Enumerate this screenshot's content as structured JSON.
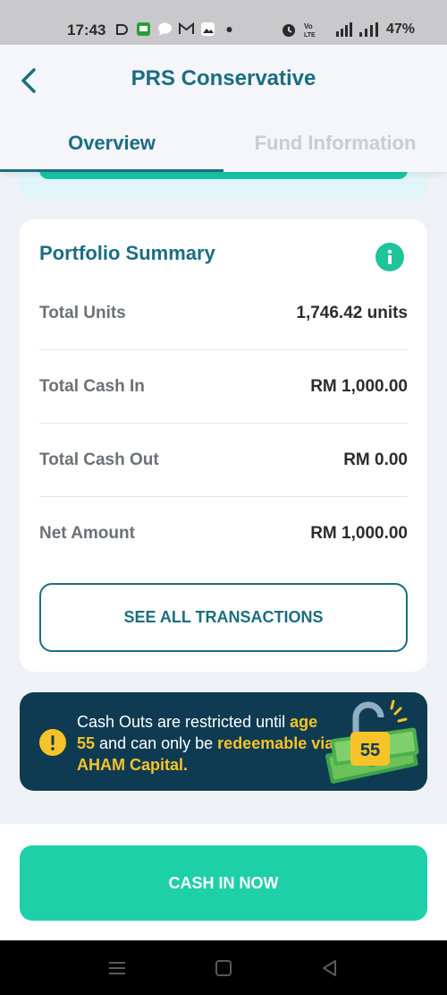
{
  "status_bar": {
    "time": "17:43",
    "battery": "47%",
    "icons_left": [
      "sync-icon",
      "chat-app-icon",
      "message-icon",
      "mail-icon",
      "gallery-icon",
      "dot-icon"
    ],
    "icons_right": [
      "alarm-icon",
      "volte-icon",
      "signal-4g-icon",
      "signal-icon"
    ]
  },
  "header": {
    "title": "PRS Conservative",
    "back_icon": "chevron-left-icon"
  },
  "tabs": [
    {
      "label": "Overview",
      "active": true
    },
    {
      "label": "Fund Information",
      "active": false
    }
  ],
  "summary": {
    "title": "Portfolio Summary",
    "rows": [
      {
        "label": "Total Units",
        "value": "1,746.42 units"
      },
      {
        "label": "Total Cash In",
        "value": "RM 1,000.00"
      },
      {
        "label": "Total Cash Out",
        "value": "RM 0.00"
      },
      {
        "label": "Net Amount",
        "value": "RM 1,000.00"
      }
    ],
    "see_all_label": "SEE ALL TRANSACTIONS"
  },
  "notice": {
    "text_1": "Cash Outs are restricted until",
    "highlight_1": "age 55",
    "text_2": "and can only be",
    "highlight_2": "redeemable via AHAM Capital.",
    "badge": "55"
  },
  "cta": {
    "label": "CASH IN NOW"
  },
  "colors": {
    "primary": "#1b6d82",
    "accent": "#1ed0a8",
    "banner": "#0f3b52",
    "highlight": "#f6c328"
  }
}
